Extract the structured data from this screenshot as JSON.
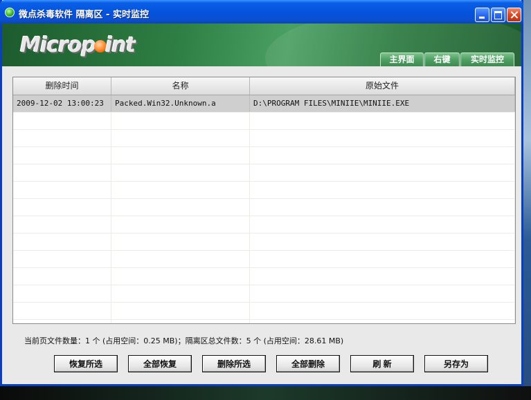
{
  "window": {
    "title": "微点杀毒软件  隔离区  -  实时监控"
  },
  "header": {
    "logo_text_left": "Microp",
    "logo_text_right": "int",
    "tabs": [
      {
        "label": "主界面"
      },
      {
        "label": "右键"
      },
      {
        "label": "实时监控"
      }
    ]
  },
  "table": {
    "columns": [
      "删除时间",
      "名称",
      "原始文件"
    ],
    "rows": [
      [
        "2009-12-02 13:00:23",
        "Packed.Win32.Unknown.a",
        "D:\\PROGRAM FILES\\MINIIE\\MINIIE.EXE"
      ]
    ]
  },
  "status": {
    "text": "当前页文件数量：1 个 (占用空间：0.25 MB)；隔离区总文件数：5 个 (占用空间：28.61 MB)"
  },
  "buttons": {
    "restore_selected": "恢复所选",
    "restore_all": "全部恢复",
    "delete_selected": "删除所选",
    "delete_all": "全部删除",
    "refresh": "刷  新",
    "save_as": "另存为"
  },
  "colors": {
    "titlebar": "#0554dd",
    "header_green": "#2f8044",
    "selected_row": "#cfcfcf"
  }
}
